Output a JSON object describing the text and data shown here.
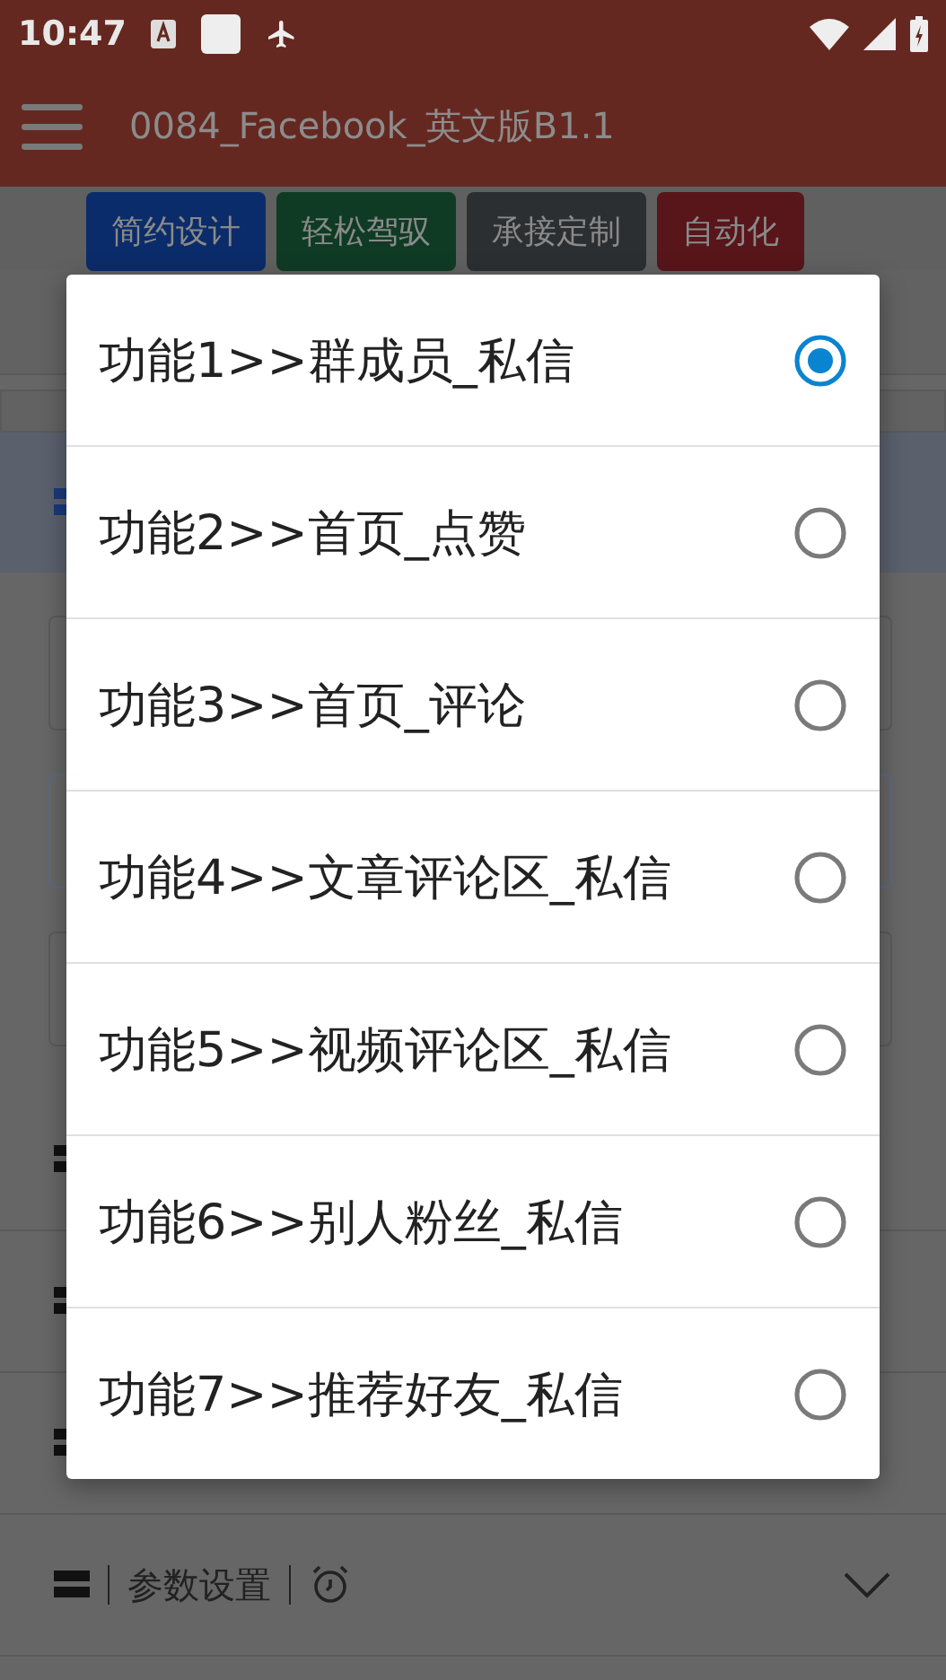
{
  "status_bar": {
    "time": "10:47"
  },
  "app_bar": {
    "title": "0084_Facebook_英文版B1.1"
  },
  "tag_buttons": [
    {
      "label": "简约设计",
      "color": "#0b2c6a"
    },
    {
      "label": "轻松驾驭",
      "color": "#0f3b24"
    },
    {
      "label": "承接定制",
      "color": "#2c2f32"
    },
    {
      "label": "自动化",
      "color": "#58151a"
    }
  ],
  "settings_row": {
    "label": "参数设置"
  },
  "dialog": {
    "options": [
      {
        "label": "功能1>>群成员_私信",
        "selected": true
      },
      {
        "label": "功能2>>首页_点赞",
        "selected": false
      },
      {
        "label": "功能3>>首页_评论",
        "selected": false
      },
      {
        "label": "功能4>>文章评论区_私信",
        "selected": false
      },
      {
        "label": "功能5>>视频评论区_私信",
        "selected": false
      },
      {
        "label": "功能6>>别人粉丝_私信",
        "selected": false
      },
      {
        "label": "功能7>>推荐好友_私信",
        "selected": false
      }
    ]
  }
}
